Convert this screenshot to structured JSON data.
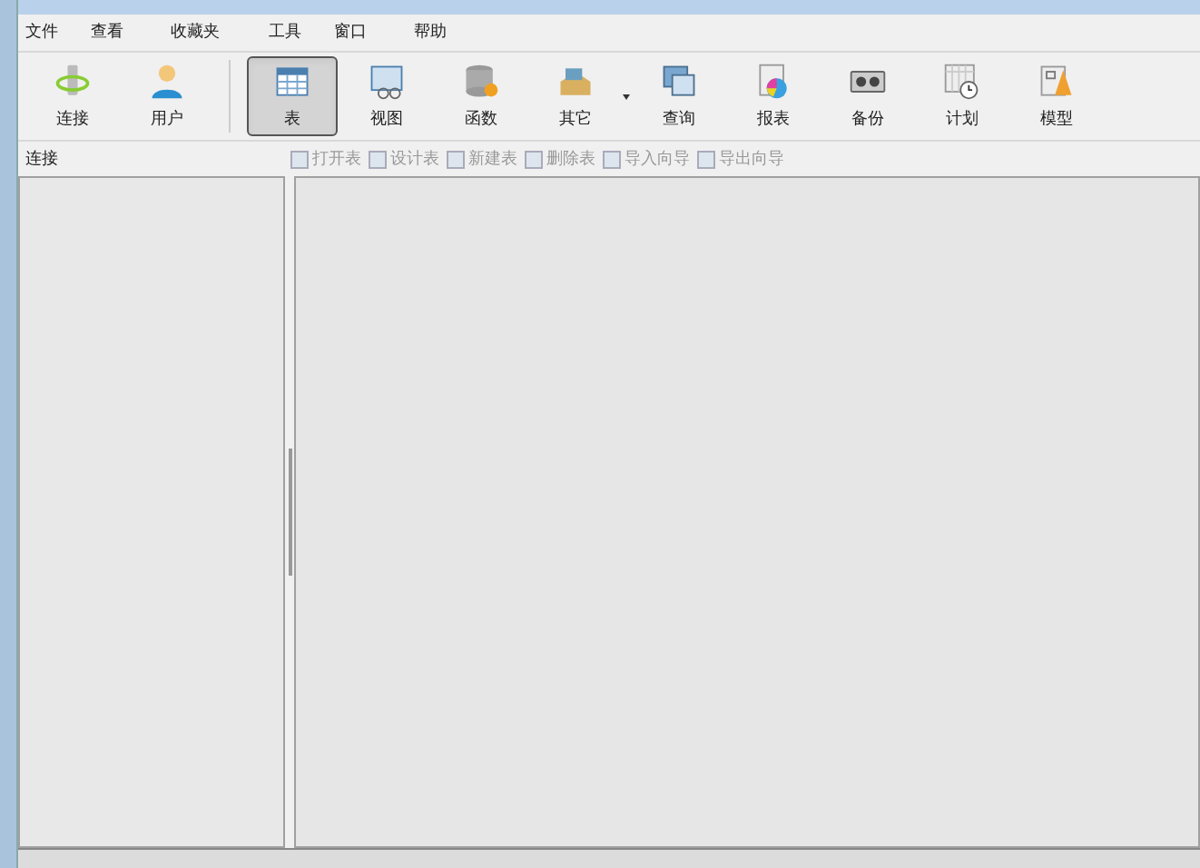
{
  "menu": [
    "文件",
    "查看",
    "收藏夹",
    "工具",
    "窗口",
    "帮助"
  ],
  "toolbar": [
    {
      "label": "连接",
      "selected": false,
      "dropdown": false
    },
    {
      "label": "用户",
      "selected": false,
      "dropdown": false
    },
    {
      "label": "表",
      "selected": true,
      "dropdown": false
    },
    {
      "label": "视图",
      "selected": false,
      "dropdown": false
    },
    {
      "label": "函数",
      "selected": false,
      "dropdown": false
    },
    {
      "label": "其它",
      "selected": false,
      "dropdown": true
    },
    {
      "label": "查询",
      "selected": false,
      "dropdown": false
    },
    {
      "label": "报表",
      "selected": false,
      "dropdown": false
    },
    {
      "label": "备份",
      "selected": false,
      "dropdown": false
    },
    {
      "label": "计划",
      "selected": false,
      "dropdown": false
    },
    {
      "label": "模型",
      "selected": false,
      "dropdown": false
    }
  ],
  "connection_panel": {
    "title": "连接"
  },
  "object_toolbar": [
    {
      "label": "打开表",
      "disabled": true
    },
    {
      "label": "设计表",
      "disabled": true
    },
    {
      "label": "新建表",
      "disabled": true
    },
    {
      "label": "删除表",
      "disabled": true
    },
    {
      "label": "导入向导",
      "disabled": true
    },
    {
      "label": "导出向导",
      "disabled": true
    }
  ]
}
